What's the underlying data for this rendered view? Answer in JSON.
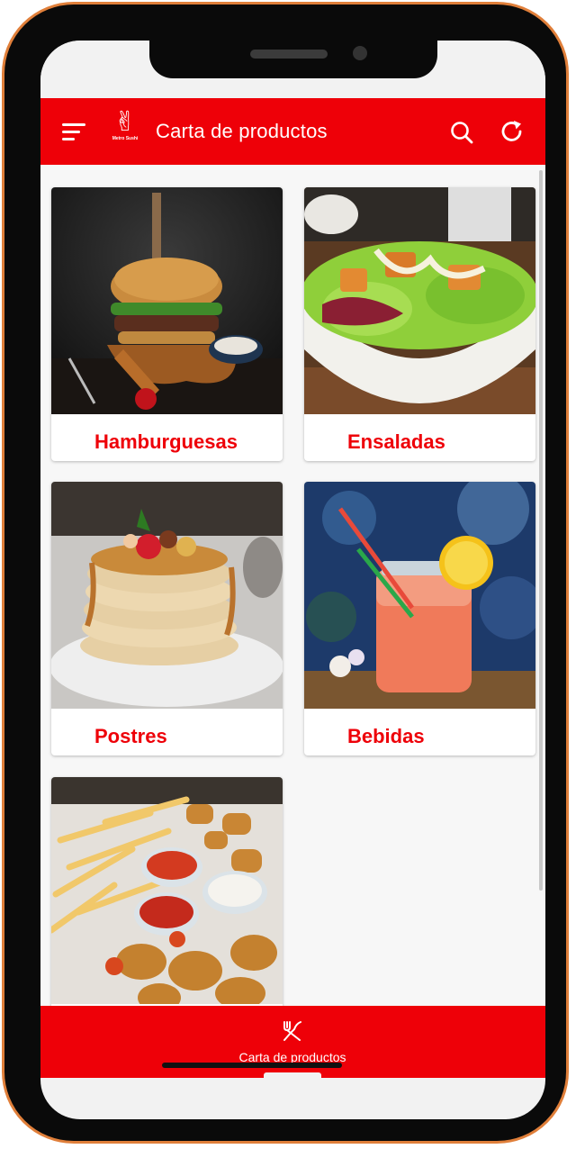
{
  "colors": {
    "brand_red": "#ee0008",
    "frame_orange": "#e07f3a",
    "background": "#f7f7f7"
  },
  "header": {
    "title": "Carta de productos",
    "logo_text": "Metro Sushi",
    "menu_icon": "menu-icon",
    "search_icon": "search-icon",
    "refresh_icon": "refresh-icon"
  },
  "categories": [
    {
      "label": "Hamburguesas",
      "image": "burger-photo"
    },
    {
      "label": "Ensaladas",
      "image": "salad-photo"
    },
    {
      "label": "Postres",
      "image": "pancakes-photo"
    },
    {
      "label": "Bebidas",
      "image": "drink-photo"
    },
    {
      "label": "",
      "image": "fries-nuggets-photo"
    }
  ],
  "bottom_nav": {
    "label": "Carta de productos",
    "icon": "fork-knife-icon"
  }
}
